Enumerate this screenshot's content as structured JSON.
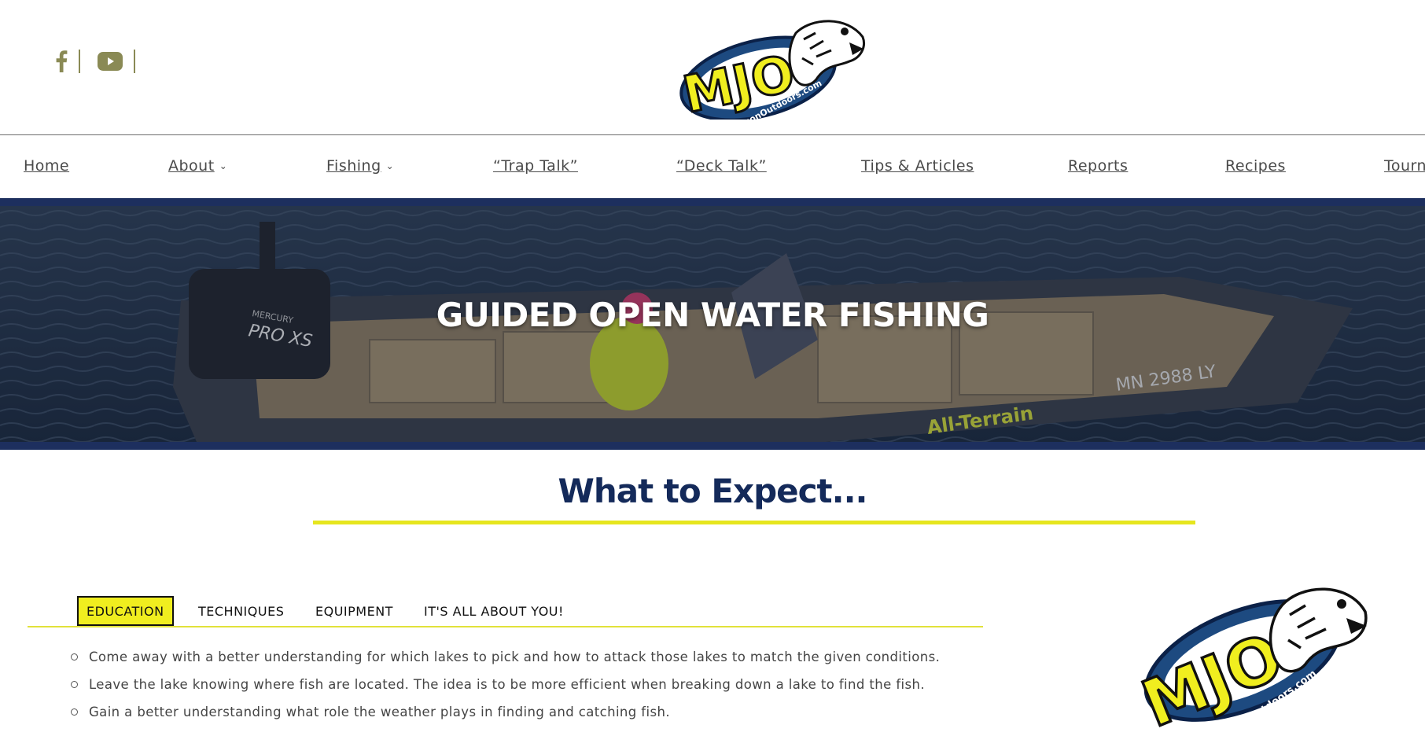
{
  "header": {
    "social_icons": [
      "facebook-icon",
      "youtube-icon"
    ],
    "logo": {
      "wordmark": "MJO",
      "site": "MattJohnsonOutdoors.com"
    }
  },
  "nav": {
    "items": [
      {
        "label": "Home",
        "has_dropdown": false
      },
      {
        "label": "About",
        "has_dropdown": true
      },
      {
        "label": "Fishing",
        "has_dropdown": true
      },
      {
        "label": "“Trap Talk”",
        "has_dropdown": false
      },
      {
        "label": "“Deck Talk”",
        "has_dropdown": false
      },
      {
        "label": "Tips & Articles",
        "has_dropdown": false
      },
      {
        "label": "Reports",
        "has_dropdown": false
      },
      {
        "label": "Recipes",
        "has_dropdown": false
      },
      {
        "label": "Tourn",
        "has_dropdown": false
      }
    ]
  },
  "hero": {
    "title": "GUIDED OPEN WATER FISHING",
    "boat_text": {
      "brand": "MERCURY",
      "model": "PRO XS",
      "registration": "MN 2988 LY",
      "hull": "All-Terrain"
    }
  },
  "section": {
    "heading": "What to Expect..."
  },
  "tabs": {
    "items": [
      "EDUCATION",
      "TECHNIQUES",
      "EQUIPMENT",
      "IT'S ALL ABOUT YOU!"
    ],
    "active": "EDUCATION",
    "bullets": [
      "Come away with a better understanding for which lakes to pick and how to attack those lakes to match the given conditions.",
      "Leave the lake knowing where fish are located. The idea is to be more efficient when breaking down a lake to find the fish.",
      "Gain a better understanding what role the weather plays in finding and catching fish."
    ]
  },
  "colors": {
    "navy": "#142a5a",
    "accent_yellow": "#f0ee1f",
    "social_olive": "#8a8a55",
    "hero_band": "#1d2f5e"
  }
}
